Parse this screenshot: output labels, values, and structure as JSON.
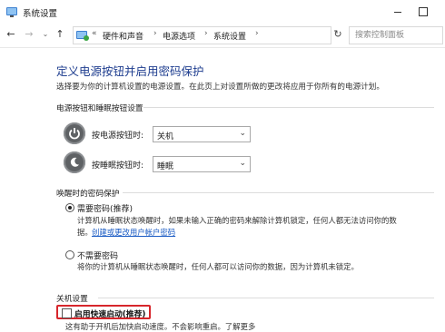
{
  "window": {
    "title": "系统设置"
  },
  "nav": {
    "breadcrumb": [
      "硬件和声音",
      "电源选项",
      "系统设置"
    ],
    "breadcrumb_overflow": "«",
    "search_placeholder": "搜索控制面板"
  },
  "page": {
    "title": "定义电源按钮并启用密码保护",
    "description": "选择要为你的计算机设置的电源设置。在此页上对设置所做的更改将应用于你所有的电源计划。"
  },
  "power_buttons": {
    "section_title": "电源按钮和睡眠按钮设置",
    "power_button_label": "按电源按钮时:",
    "power_button_value": "关机",
    "sleep_button_label": "按睡眠按钮时:",
    "sleep_button_value": "睡眠"
  },
  "wake_password": {
    "section_title": "唤醒时的密码保护",
    "require_label": "需要密码(推荐)",
    "require_desc_line1": "计算机从睡眠状态唤醒时，如果未输入正确的密码来解除计算机锁定，任何人都无法访问你的数",
    "require_desc_line2_prefix": "据。",
    "require_link": "创建或更改用户帐户密码",
    "require_selected": true,
    "norequire_label": "不需要密码",
    "norequire_desc": "将你的计算机从睡眠状态唤醒时，任何人都可以访问你的数据，因为计算机未锁定。"
  },
  "shutdown": {
    "section_title": "关机设置",
    "fast_startup_label": "启用快速启动(推荐)",
    "fast_startup_checked": false,
    "fast_startup_desc": "这有助于开机后加快启动速度。不会影响重启。了解更多"
  },
  "colors": {
    "title_blue": "#1e3d8f",
    "link_blue": "#1a5bc4",
    "highlight_red": "#d7262c"
  }
}
